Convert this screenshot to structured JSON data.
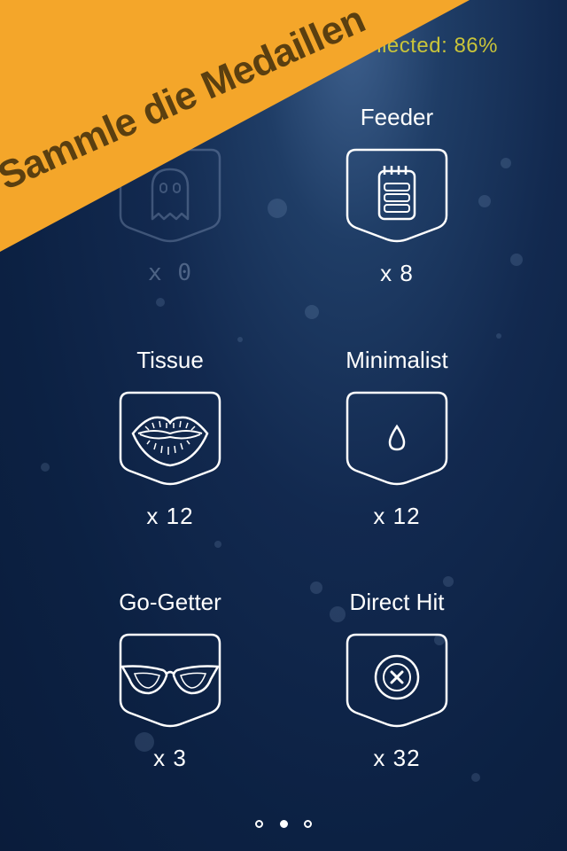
{
  "header": {
    "collected_text": "Collected: 86%"
  },
  "banner": {
    "text": "Sammle die Medaillen",
    "color": "#f4a62a"
  },
  "medals": [
    {
      "name": "",
      "count": "x 0",
      "icon": "ghost-icon",
      "earned": false
    },
    {
      "name": "Feeder",
      "count": "x 8",
      "icon": "notepad-icon",
      "earned": true
    },
    {
      "name": "Tissue",
      "count": "x 12",
      "icon": "lips-icon",
      "earned": true
    },
    {
      "name": "Minimalist",
      "count": "x 12",
      "icon": "drop-icon",
      "earned": true
    },
    {
      "name": "Go-Getter",
      "count": "x 3",
      "icon": "glasses-icon",
      "earned": true
    },
    {
      "name": "Direct Hit",
      "count": "x 32",
      "icon": "button-icon",
      "earned": true
    }
  ],
  "pager": {
    "pages": 3,
    "current": 2
  },
  "colors": {
    "background": "#0c2143",
    "collected": "#c9c43a",
    "banner_text": "#5a3f10"
  }
}
